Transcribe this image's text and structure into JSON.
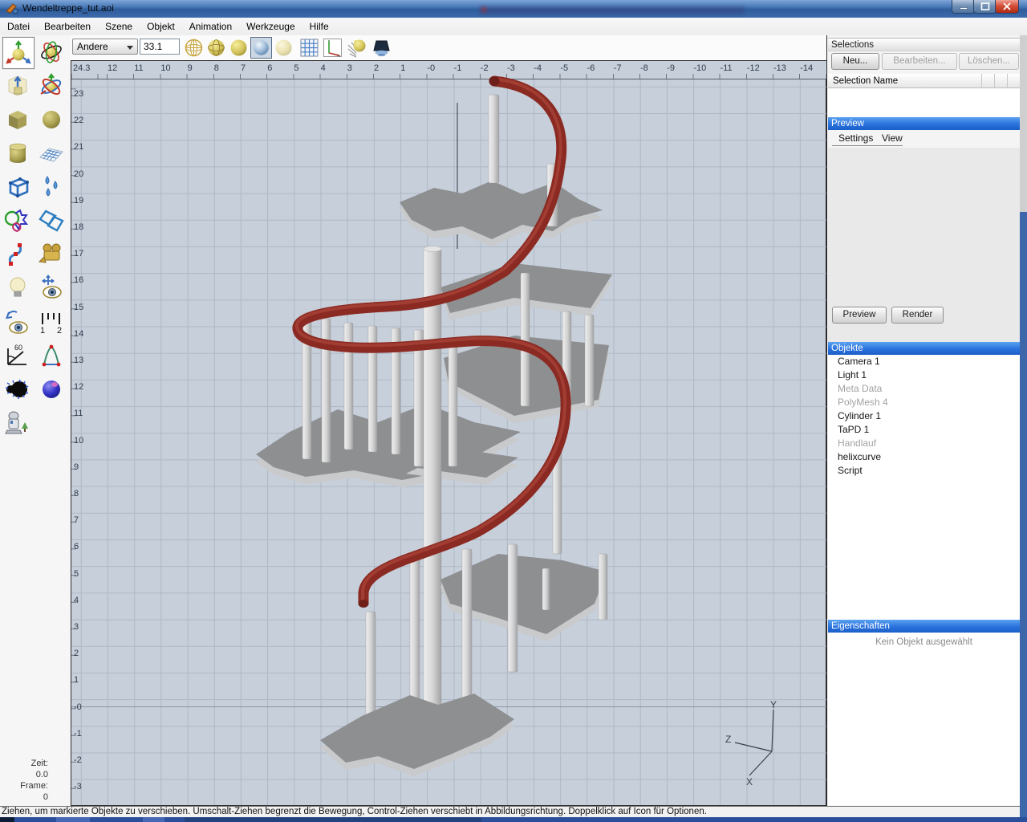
{
  "window": {
    "title": "Wendeltreppe_tut.aoi"
  },
  "menu": {
    "items": [
      "Datei",
      "Bearbeiten",
      "Szene",
      "Objekt",
      "Animation",
      "Werkzeuge",
      "Hilfe"
    ]
  },
  "toolbar": {
    "mode_select_value": "Andere",
    "grid_size_value": "33.1",
    "icons": [
      "wireframe-display",
      "mesh-display",
      "smooth-display",
      "textured-display",
      "flat-display",
      "grid-toggle",
      "coordinate-axes",
      "render-preview",
      "scene-lamp"
    ],
    "pressed_icon": "textured-display"
  },
  "tool_palette": {
    "tools": [
      {
        "name": "move-object",
        "selected": true
      },
      {
        "name": "rotate-object"
      },
      {
        "name": "resize-object"
      },
      {
        "name": "rotate-view-axes"
      },
      {
        "name": "create-cube"
      },
      {
        "name": "create-sphere"
      },
      {
        "name": "create-cylinder"
      },
      {
        "name": "create-spline-mesh"
      },
      {
        "name": "create-polymesh"
      },
      {
        "name": "create-fluid-drops"
      },
      {
        "name": "boolean-modelling"
      },
      {
        "name": "create-tube"
      },
      {
        "name": "create-curve"
      },
      {
        "name": "create-camera"
      },
      {
        "name": "create-light"
      },
      {
        "name": "pan-view"
      },
      {
        "name": "rotate-view"
      },
      {
        "name": "measure-tool",
        "glyph_left": "1",
        "glyph_right": "2"
      },
      {
        "name": "protractor-tool",
        "glyph": "60"
      },
      {
        "name": "create-polygon"
      },
      {
        "name": "fractal-tool"
      },
      {
        "name": "texture-ball"
      },
      {
        "name": "scripted-object"
      }
    ]
  },
  "viewport": {
    "h_ruler": [
      "24.3",
      "12",
      "11",
      "10",
      "9",
      "8",
      "7",
      "6",
      "5",
      "4",
      "3",
      "2",
      "1",
      "-0",
      "-1",
      "-2",
      "-3",
      "-4",
      "-5",
      "-6",
      "-7",
      "-8",
      "-9",
      "-10",
      "-11",
      "-12",
      "-13",
      "-14"
    ],
    "v_ruler": [
      "23",
      "22",
      "21",
      "20",
      "19",
      "18",
      "17",
      "16",
      "15",
      "14",
      "13",
      "12",
      "11",
      "10",
      "9",
      "8",
      "7",
      "6",
      "5",
      "4",
      "3",
      "2",
      "1",
      "-0",
      "-1",
      "-2",
      "-3"
    ],
    "axis_indicator": {
      "x": "X",
      "y": "Y",
      "z": "Z"
    },
    "colors": {
      "background": "#c7cfda",
      "grid_line": "#aeb8c6",
      "handrail": "#8b2a22",
      "platform": "#8d8f91",
      "platform_edge": "#c9cacb",
      "post_light": "#ececec",
      "post_dark": "#a5a6a8"
    }
  },
  "right_panel": {
    "selections": {
      "title": "Selections",
      "buttons": [
        {
          "label": "Neu...",
          "enabled": true
        },
        {
          "label": "Bearbeiten...",
          "enabled": false
        },
        {
          "label": "Löschen...",
          "enabled": false
        }
      ],
      "column_header": "Selection Name"
    },
    "preview": {
      "title": "Preview",
      "tabs": [
        "Settings",
        "View"
      ],
      "active_tab": "Settings",
      "preview_button": "Preview",
      "render_button": "Render"
    },
    "objects": {
      "title": "Objekte",
      "items": [
        {
          "name": "Camera 1",
          "dimmed": false
        },
        {
          "name": "Light 1",
          "dimmed": false
        },
        {
          "name": "Meta Data",
          "dimmed": true
        },
        {
          "name": "PolyMesh 4",
          "dimmed": true
        },
        {
          "name": "Cylinder 1",
          "dimmed": false
        },
        {
          "name": "TaPD 1",
          "dimmed": false
        },
        {
          "name": "Handlauf",
          "dimmed": true
        },
        {
          "name": "helixcurve",
          "dimmed": false
        },
        {
          "name": "Script",
          "dimmed": false
        }
      ]
    },
    "properties": {
      "title": "Eigenschaften",
      "empty_text": "Kein Objekt ausgewählt"
    }
  },
  "timeline": {
    "time_label": "Zeit:",
    "time_value": "0.0",
    "frame_label": "Frame:",
    "frame_value": "0"
  },
  "status_bar": {
    "text": "Ziehen, um markierte Objekte zu verschieben. Umschalt-Ziehen begrenzt die Bewegung, Control-Ziehen verschiebt in Abbildungsrichtung. Doppelklick auf Icon für Optionen."
  }
}
